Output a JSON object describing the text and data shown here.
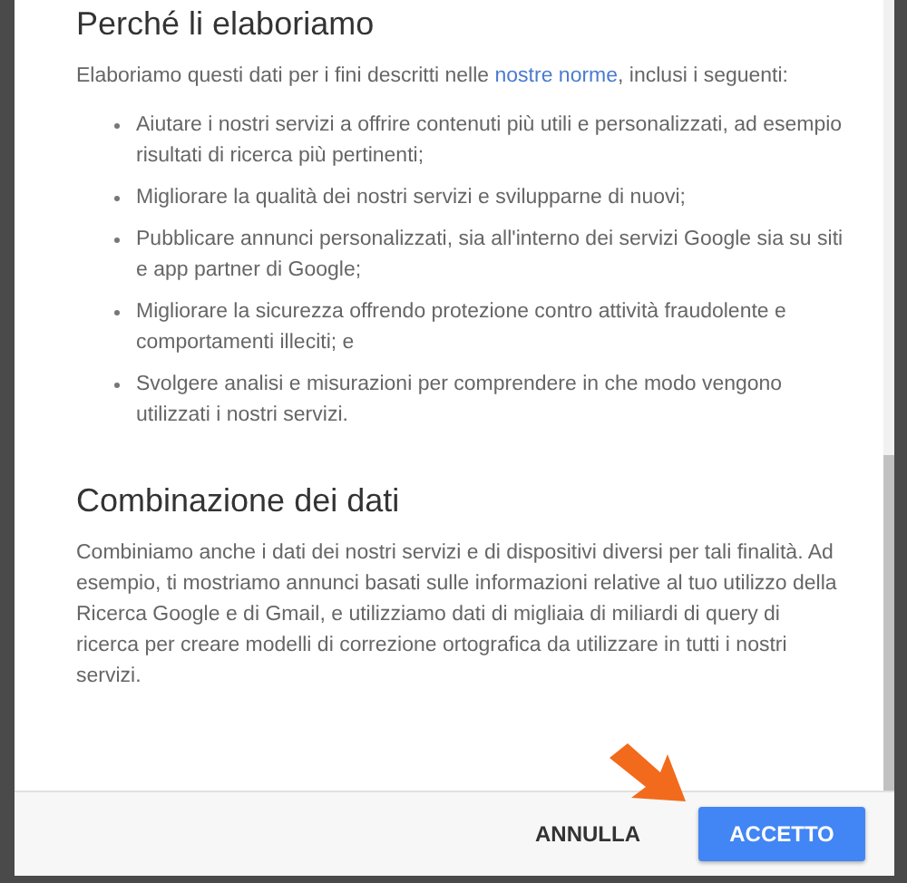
{
  "dialog": {
    "sections": [
      {
        "heading": "Perché li elaboriamo",
        "intro": {
          "before": "Elaboriamo questi dati per i fini descritti nelle ",
          "link": "nostre norme",
          "after": ", inclusi i seguenti:"
        },
        "bullets": [
          "Aiutare i nostri servizi a offrire contenuti più utili e personalizzati, ad esempio risultati di ricerca più pertinenti;",
          "Migliorare la qualità dei nostri servizi e svilupparne di nuovi;",
          "Pubblicare annunci personalizzati, sia all'interno dei servizi Google sia su siti e app partner di Google;",
          "Migliorare la sicurezza offrendo protezione contro attività fraudolente e comportamenti illeciti; e",
          "Svolgere analisi e misurazioni per comprendere in che modo vengono utilizzati i nostri servizi."
        ]
      },
      {
        "heading": "Combinazione dei dati",
        "paragraph": "Combiniamo anche i dati dei nostri servizi e di dispositivi diversi per tali finalità. Ad esempio, ti mostriamo annunci basati sulle informazioni relative al tuo utilizzo della Ricerca Google e di Gmail, e utilizziamo dati di migliaia di miliardi di query di ricerca per creare modelli di correzione ortografica da utilizzare in tutti i nostri servizi."
      }
    ],
    "buttons": [
      {
        "label": "ANNULLA",
        "kind": "flat"
      },
      {
        "label": "ACCETTO",
        "kind": "primary"
      }
    ]
  }
}
